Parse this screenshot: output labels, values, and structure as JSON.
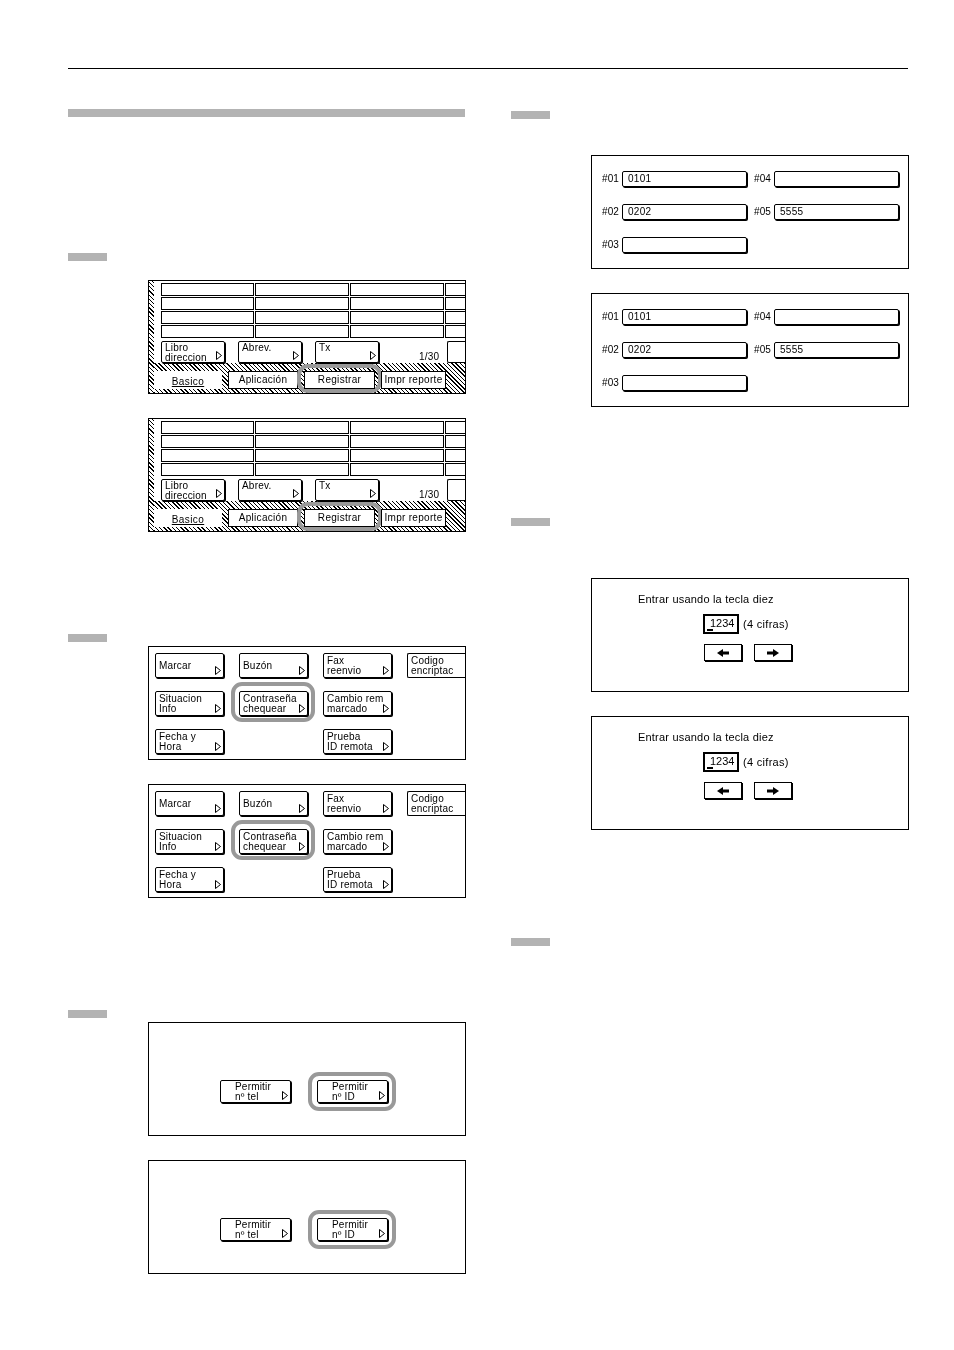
{
  "left_column": {
    "steps": [
      {
        "screens": [
          {
            "kind": "address_book",
            "buttons": [
              {
                "label": "Libro\ndireccion"
              },
              {
                "label": "Abrev."
              },
              {
                "label": "Tx"
              }
            ],
            "page_counter": "1/30",
            "tabs": [
              {
                "label": "Basico",
                "selected": true,
                "highlighted": false
              },
              {
                "label": "Aplicación",
                "selected": false,
                "highlighted": false
              },
              {
                "label": "Registrar",
                "selected": false,
                "highlighted": true
              },
              {
                "label": "Impr reporte",
                "selected": false,
                "highlighted": false
              }
            ]
          },
          {
            "kind": "address_book",
            "buttons": [
              {
                "label": "Libro\ndireccion"
              },
              {
                "label": "Abrev."
              },
              {
                "label": "Tx"
              }
            ],
            "page_counter": "1/30",
            "tabs": [
              {
                "label": "Basico",
                "selected": true,
                "highlighted": false
              },
              {
                "label": "Aplicación",
                "selected": false,
                "highlighted": false
              },
              {
                "label": "Registrar",
                "selected": false,
                "highlighted": true
              },
              {
                "label": "Impr reporte",
                "selected": false,
                "highlighted": false
              }
            ]
          }
        ]
      },
      {
        "screens": [
          {
            "kind": "menu",
            "rows": [
              [
                {
                  "kind": "button",
                  "label": "Marcar",
                  "highlighted": false
                },
                {
                  "kind": "button",
                  "label": "Buzón",
                  "highlighted": false
                },
                {
                  "kind": "button",
                  "label": "Fax\nreenvio",
                  "highlighted": false
                },
                {
                  "kind": "button",
                  "label": "Codigo\nencriptac",
                  "highlighted": false
                }
              ],
              [
                {
                  "kind": "button",
                  "label": "Situacion\nInfo",
                  "highlighted": false
                },
                {
                  "kind": "button",
                  "label": "Contraseña\nchequear",
                  "highlighted": true
                },
                {
                  "kind": "button",
                  "label": "Cambio rem\nmarcado",
                  "highlighted": false
                }
              ],
              [
                {
                  "kind": "button",
                  "label": "Fecha y\nHora",
                  "highlighted": false
                },
                {
                  "kind": "empty"
                },
                {
                  "kind": "button",
                  "label": "Prueba\nID remota",
                  "highlighted": false
                }
              ]
            ]
          },
          {
            "kind": "menu",
            "rows": [
              [
                {
                  "kind": "button",
                  "label": "Marcar",
                  "highlighted": false
                },
                {
                  "kind": "button",
                  "label": "Buzón",
                  "highlighted": false
                },
                {
                  "kind": "button",
                  "label": "Fax\nreenvio",
                  "highlighted": false
                },
                {
                  "kind": "button",
                  "label": "Codigo\nencriptac",
                  "highlighted": false
                }
              ],
              [
                {
                  "kind": "button",
                  "label": "Situacion\nInfo",
                  "highlighted": false
                },
                {
                  "kind": "button",
                  "label": "Contraseña\nchequear",
                  "highlighted": true
                },
                {
                  "kind": "button",
                  "label": "Cambio rem\nmarcado",
                  "highlighted": false
                }
              ],
              [
                {
                  "kind": "button",
                  "label": "Fecha y\nHora",
                  "highlighted": false
                },
                {
                  "kind": "empty"
                },
                {
                  "kind": "button",
                  "label": "Prueba\nID remota",
                  "highlighted": false
                }
              ]
            ]
          }
        ]
      },
      {
        "screens": [
          {
            "kind": "permit",
            "buttons": [
              {
                "label": "Permitir\nnº tel",
                "highlighted": false
              },
              {
                "label": "Permitir\nnº ID",
                "highlighted": true
              }
            ]
          },
          {
            "kind": "permit",
            "buttons": [
              {
                "label": "Permitir\nnº tel",
                "highlighted": false
              },
              {
                "label": "Permitir\nnº ID",
                "highlighted": true
              }
            ]
          }
        ]
      }
    ]
  },
  "right_column": {
    "steps": [
      {
        "screens": [
          {
            "kind": "id_list",
            "columns": [
              [
                {
                  "label": "#01",
                  "value": "0101"
                },
                {
                  "label": "#02",
                  "value": "0202"
                },
                {
                  "label": "#03"
                }
              ],
              [
                {
                  "label": "#04"
                },
                {
                  "label": "#05",
                  "value": "5555"
                }
              ]
            ]
          },
          {
            "kind": "id_list",
            "columns": [
              [
                {
                  "label": "#01",
                  "value": "0101"
                },
                {
                  "label": "#02",
                  "value": "0202"
                },
                {
                  "label": "#03"
                }
              ],
              [
                {
                  "label": "#04"
                },
                {
                  "label": "#05",
                  "value": "5555"
                }
              ]
            ]
          }
        ]
      },
      {
        "screens": [
          {
            "kind": "code_entry",
            "prompt": "Entrar usando la tecla diez",
            "value": "1234",
            "note": "(4 cifras)"
          },
          {
            "kind": "code_entry",
            "prompt": "Entrar usando la tecla diez",
            "value": "1234",
            "note": "(4 cifras)"
          }
        ]
      }
    ]
  }
}
